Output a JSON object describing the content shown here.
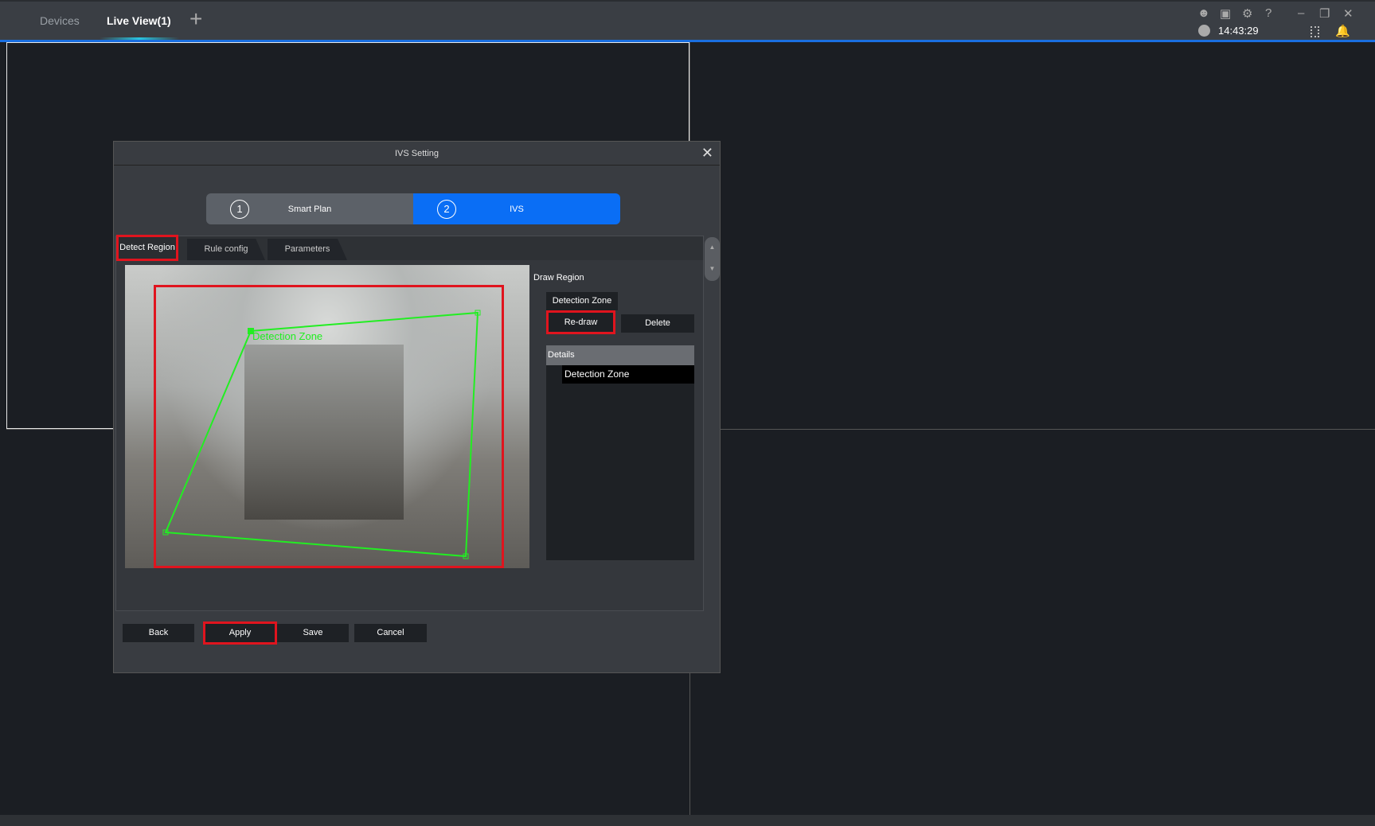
{
  "topbar": {
    "tabs": [
      "Devices",
      "Live View(1)"
    ],
    "add_tab": "+",
    "time": "14:43:29",
    "icons": [
      "user-icon",
      "lock-icon",
      "gear-icon",
      "help-icon",
      "minimize-icon",
      "restore-icon",
      "close-icon",
      "clock-icon",
      "device-icon",
      "bell-icon"
    ]
  },
  "dialog": {
    "title": "IVS Setting",
    "steps": [
      {
        "num": "1",
        "label": "Smart Plan"
      },
      {
        "num": "2",
        "label": "IVS"
      }
    ],
    "tabs": [
      "Detect Region",
      "Rule config",
      "Parameters"
    ],
    "draw_region_label": "Draw Region",
    "zone_button": "Detection Zone",
    "redraw": "Re-draw",
    "delete": "Delete",
    "details_header": "Details",
    "details_items": [
      "Detection Zone"
    ],
    "zone_overlay_label": "Detection Zone",
    "buttons": {
      "back": "Back",
      "apply": "Apply",
      "save": "Save",
      "cancel": "Cancel"
    }
  },
  "colors": {
    "accent": "#0a6ef5",
    "highlight": "#e0141e",
    "zone": "#22ee22"
  }
}
